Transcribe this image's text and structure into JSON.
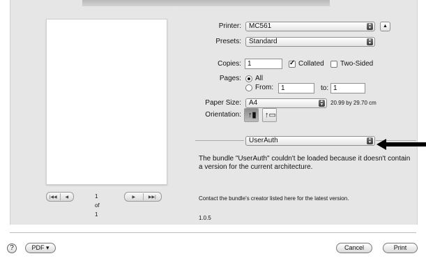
{
  "printer": {
    "label": "Printer:",
    "value": "MC561"
  },
  "presets": {
    "label": "Presets:",
    "value": "Standard"
  },
  "copies": {
    "label": "Copies:",
    "value": "1",
    "collated_label": "Collated",
    "collated": true,
    "two_sided_label": "Two-Sided",
    "two_sided": false
  },
  "pages": {
    "label": "Pages:",
    "all_label": "All",
    "from_label": "From:",
    "from_value": "1",
    "to_label": "to:",
    "to_value": "1",
    "selected": "All"
  },
  "paper_size": {
    "label": "Paper Size:",
    "value": "A4",
    "dimensions": "20.99 by 29.70 cm"
  },
  "orientation": {
    "label": "Orientation:",
    "selected": "portrait"
  },
  "section_popup": {
    "value": "UserAuth"
  },
  "message": {
    "error": "The bundle \"UserAuth\" couldn't be loaded because it doesn't contain a version for the current architecture.",
    "contact": "Contact the bundle's creator listed here for the latest version.",
    "version": "1.0.5"
  },
  "preview": {
    "page_indicator": "1 of 1"
  },
  "buttons": {
    "help": "?",
    "pdf": "PDF ▾",
    "cancel": "Cancel",
    "print": "Print"
  },
  "icons": [
    "first-page-icon",
    "prev-page-icon",
    "next-page-icon",
    "last-page-icon",
    "portrait-icon",
    "landscape-icon",
    "stepper-icon",
    "disclosure-icon",
    "arrow-icon"
  ]
}
